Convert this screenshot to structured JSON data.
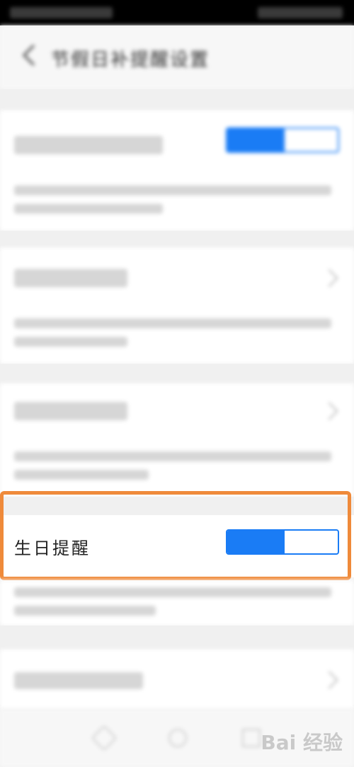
{
  "header": {
    "title": "节假日补提醒设置"
  },
  "settings": {
    "birthday": {
      "label": "生日提醒",
      "enabled": true
    }
  },
  "watermark": "Bai 经验",
  "colors": {
    "accent": "#1a7cf5",
    "highlight": "#ef8a3a"
  }
}
